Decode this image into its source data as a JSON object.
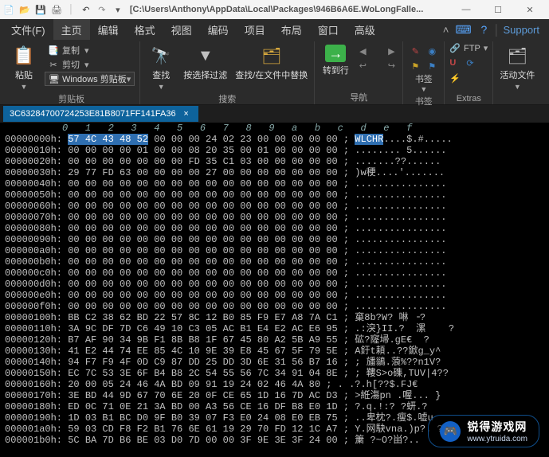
{
  "titlebar": {
    "path": "[C:\\Users\\Anthony\\AppData\\Local\\Packages\\946B6A6E.WoLongFalle..."
  },
  "winctl": {
    "min": "—",
    "max": "☐",
    "close": "✕"
  },
  "menu": {
    "file": "文件(F)",
    "home": "主页",
    "edit": "编辑",
    "format": "格式",
    "view": "视图",
    "coding": "编码",
    "project": "项目",
    "layout": "布局",
    "window": "窗口",
    "advanced": "高级",
    "support": "Support"
  },
  "ribbon": {
    "clipboard": {
      "paste": "粘贴",
      "copy": "复制",
      "cut": "剪切",
      "clip_history": "Windows 剪贴板",
      "title": "剪贴板"
    },
    "search": {
      "find": "查找",
      "press_filter": "按选择过滤",
      "find_replace": "查找/在文件中替换",
      "title": "搜索"
    },
    "nav": {
      "goto_line": "转到行",
      "title": "导航"
    },
    "bookmarks": {
      "btn": "书签",
      "title": "书签"
    },
    "extras": {
      "ftp": "FTP",
      "title": "Extras"
    },
    "files": {
      "btn": "活动文件",
      "title": ""
    }
  },
  "tab": {
    "name": "3C63284700724253E81B8071FF141FA36",
    "close": "×"
  },
  "hex": {
    "col_header": "          0   1   2   3   4   5   6   7   8   9   a   b   c   d   e   f",
    "rows": [
      {
        "off": "00000000h:",
        "sel": "57 4C 43 48 52",
        "rest": " 00 00 00 24 02 23 00 00 00 00 00 ; ",
        "ascii_sel": "WLCHR",
        "ascii": "....$.#....."
      },
      {
        "off": "00000010h:",
        "sel": "",
        "rest": "00 00 00 00 01 00 00 08 20 35 00 01 00 00 00 00 ; ",
        "ascii_sel": "",
        "ascii": "........ 5......"
      },
      {
        "off": "00000020h:",
        "sel": "",
        "rest": "00 00 00 00 00 00 00 FD 35 C1 03 00 00 00 00 00 ; ",
        "ascii_sel": "",
        "ascii": ".......??......"
      },
      {
        "off": "00000030h:",
        "sel": "",
        "rest": "29 77 FD 63 00 00 00 00 27 00 00 00 00 00 00 00 ; ",
        "ascii_sel": "",
        "ascii": ")w稉....'......."
      },
      {
        "off": "00000040h:",
        "sel": "",
        "rest": "00 00 00 00 00 00 00 00 00 00 00 00 00 00 00 00 ; ",
        "ascii_sel": "",
        "ascii": "................"
      },
      {
        "off": "00000050h:",
        "sel": "",
        "rest": "00 00 00 00 00 00 00 00 00 00 00 00 00 00 00 00 ; ",
        "ascii_sel": "",
        "ascii": "................"
      },
      {
        "off": "00000060h:",
        "sel": "",
        "rest": "00 00 00 00 00 00 00 00 00 00 00 00 00 00 00 00 ; ",
        "ascii_sel": "",
        "ascii": "................"
      },
      {
        "off": "00000070h:",
        "sel": "",
        "rest": "00 00 00 00 00 00 00 00 00 00 00 00 00 00 00 00 ; ",
        "ascii_sel": "",
        "ascii": "................"
      },
      {
        "off": "00000080h:",
        "sel": "",
        "rest": "00 00 00 00 00 00 00 00 00 00 00 00 00 00 00 00 ; ",
        "ascii_sel": "",
        "ascii": "................"
      },
      {
        "off": "00000090h:",
        "sel": "",
        "rest": "00 00 00 00 00 00 00 00 00 00 00 00 00 00 00 00 ; ",
        "ascii_sel": "",
        "ascii": "................"
      },
      {
        "off": "000000a0h:",
        "sel": "",
        "rest": "00 00 00 00 00 00 00 00 00 00 00 00 00 00 00 00 ; ",
        "ascii_sel": "",
        "ascii": "................"
      },
      {
        "off": "000000b0h:",
        "sel": "",
        "rest": "00 00 00 00 00 00 00 00 00 00 00 00 00 00 00 00 ; ",
        "ascii_sel": "",
        "ascii": "................"
      },
      {
        "off": "000000c0h:",
        "sel": "",
        "rest": "00 00 00 00 00 00 00 00 00 00 00 00 00 00 00 00 ; ",
        "ascii_sel": "",
        "ascii": "................"
      },
      {
        "off": "000000d0h:",
        "sel": "",
        "rest": "00 00 00 00 00 00 00 00 00 00 00 00 00 00 00 00 ; ",
        "ascii_sel": "",
        "ascii": "................"
      },
      {
        "off": "000000e0h:",
        "sel": "",
        "rest": "00 00 00 00 00 00 00 00 00 00 00 00 00 00 00 00 ; ",
        "ascii_sel": "",
        "ascii": "................"
      },
      {
        "off": "000000f0h:",
        "sel": "",
        "rest": "00 00 00 00 00 00 00 00 00 00 00 00 00 00 00 00 ; ",
        "ascii_sel": "",
        "ascii": "................"
      },
      {
        "off": "00000100h:",
        "sel": "",
        "rest": "BB C2 38 62 BD 22 57 8C 12 B0 85 F9 E7 A8 7A C1 ; ",
        "ascii_sel": "",
        "ascii": "窼8b?W? 啉 ╶?"
      },
      {
        "off": "00000110h:",
        "sel": "",
        "rest": "3A 9C DF 7D C6 49 10 C3 05 AC B1 E4 E2 AC E6 95 ; ",
        "ascii_sel": "",
        "ascii": ".:湥}II.?  漯    ?"
      },
      {
        "off": "00000120h:",
        "sel": "",
        "rest": "B7 AF 90 34 9B F1 8B B8 1F 67 45 80 A2 5B A9 55 ; ",
        "ascii_sel": "",
        "ascii": "砿?窿埽.gE€  ?"
      },
      {
        "off": "00000130h:",
        "sel": "",
        "rest": "41 E2 44 74 EE 85 4C 10 9E 39 E8 45 67 5F 79 5E ; ",
        "ascii_sel": "",
        "ascii": "A釪t頛..??鍁g_y^"
      },
      {
        "off": "00000140h:",
        "sel": "",
        "rest": "94 F7 F9 4F 0D C9 87 DD 25 DD 3D 6E 31 56 B7 16 ; ",
        "ascii_sel": "",
        "ascii": "; 旙鶲.蒗%??n1V?"
      },
      {
        "off": "00000150h:",
        "sel": "",
        "rest": "EC 7C 53 3E 6F B4 B8 2C 54 55 56 7C 34 91 04 8E ; ",
        "ascii_sel": "",
        "ascii": "; 鞻S>o磼,TUV|4??"
      },
      {
        "off": "00000160h:",
        "sel": "",
        "rest": "20 00 05 24 46 4A BD 09 91 19 24 02 46 4A 80 ; ",
        "ascii_sel": "",
        "ascii": ". .?.h[??$.FJ€"
      },
      {
        "off": "00000170h:",
        "sel": "",
        "rest": "3E BD 44 9D 67 70 6E 20 0F CE 65 1D 16 7D AC D3 ; ",
        "ascii_sel": "",
        "ascii": ">絍漡pn .喔... }"
      },
      {
        "off": "00000180h:",
        "sel": "",
        "rest": "ED 0C 71 0E 21 3A BD 00 A3 56 CE 16 DF B8 E0 1D ; ",
        "ascii_sel": "",
        "ascii": "?.q.!:? ?蚈.?"
      },
      {
        "off": "00000190h:",
        "sel": "",
        "rest": "1D 03 B1 BC D0 9F B0 39 07 F3 E0 24 08 E0 EB 75 ; ",
        "ascii_sel": "",
        "ascii": "..卑枕?.瘦$.嘘u"
      },
      {
        "off": "000001a0h:",
        "sel": "",
        "rest": "59 03 CD F8 F2 B1 76 6E 61 19 29 70 FD 12 1C A7 ; ",
        "ascii_sel": "",
        "ascii": "Y.网駃vna.)p?. ?"
      },
      {
        "off": "000001b0h:",
        "sel": "",
        "rest": "5C BA 7D B6 BE 03 D0 7D 00 00 3F 9E 3E 3F 24 00 ; ",
        "ascii_sel": "",
        "ascii": "簘 ?~O?畄?.."
      }
    ]
  },
  "watermark": {
    "name": "锐得游戏网",
    "url": "www.ytruida.com"
  }
}
